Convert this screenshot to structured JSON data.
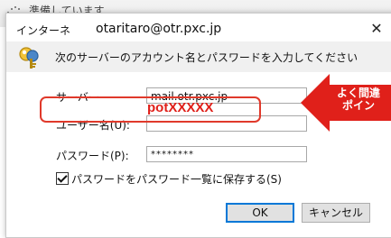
{
  "background": {
    "status_text": "準備しています"
  },
  "dialog": {
    "title_app": "インターネ",
    "title_host": "otaritaro@otr.pxc.jp",
    "message": "次のサーバーのアカウント名とパスワードを入力してください",
    "server_label": "サーバー",
    "server_value": "mail.otr.pxc.jp",
    "username_label": "ユーザー名(U):",
    "username_value": "potXXXXX",
    "password_label": "パスワード(P):",
    "password_value": "********",
    "save_password_label": "パスワードをパスワード一覧に保存する(S)",
    "save_password_checked": true,
    "ok_label": "OK",
    "cancel_label": "キャンセル",
    "close_icon": "close-icon"
  },
  "callout": {
    "line1": "よく間違",
    "line2": "ポイン",
    "color": "#e0201a"
  },
  "colors": {
    "highlight": "#e0392b",
    "accent": "#0078d7"
  }
}
